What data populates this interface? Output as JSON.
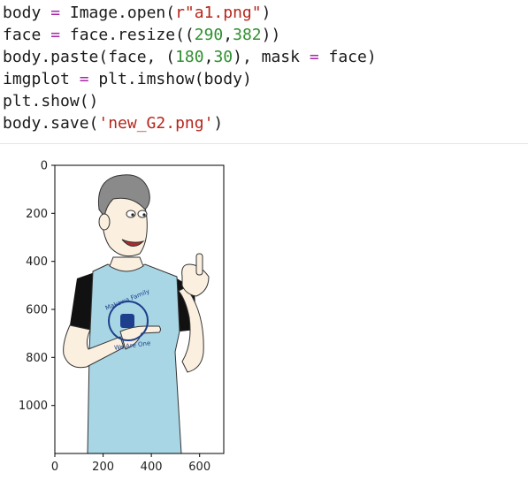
{
  "code": {
    "line1": {
      "a": "body ",
      "op": "=",
      "b": " Image.open(",
      "s": "r\"a1.png\"",
      "c": ")"
    },
    "line2": {
      "a": "face ",
      "op": "=",
      "b": " face.resize((",
      "n1": "290",
      "comma": ",",
      "n2": "382",
      "c": "))"
    },
    "line3": {
      "a": "body.paste(face, (",
      "n1": "180",
      "comma": ",",
      "n2": "30",
      "b": "), mask ",
      "op": "=",
      "c": " face)"
    },
    "line4": {
      "a": "imgplot ",
      "op": "=",
      "b": " plt.imshow(body)"
    },
    "line5": {
      "a": "plt.show()"
    },
    "line6": {
      "a": "body.save(",
      "s": "'new_G2.png'",
      "c": ")"
    }
  },
  "plot": {
    "image_content": "cartoon man in light blue t-shirt pointing at shirt logo with thumbs up",
    "shirt_text_top": "Makawa Family",
    "shirt_text_bottom": "We Are One",
    "xticks": [
      "0",
      "200",
      "400",
      "600"
    ],
    "yticks": [
      "0",
      "200",
      "400",
      "600",
      "800",
      "1000"
    ],
    "xlim": [
      0,
      700
    ],
    "ylim": [
      0,
      1200
    ],
    "colors": {
      "shirt": "#a9d6e5",
      "sleeve": "#111111",
      "skin": "#fbf0e0",
      "hair": "#8a8a8a",
      "logo": "#1e3f8c"
    }
  }
}
